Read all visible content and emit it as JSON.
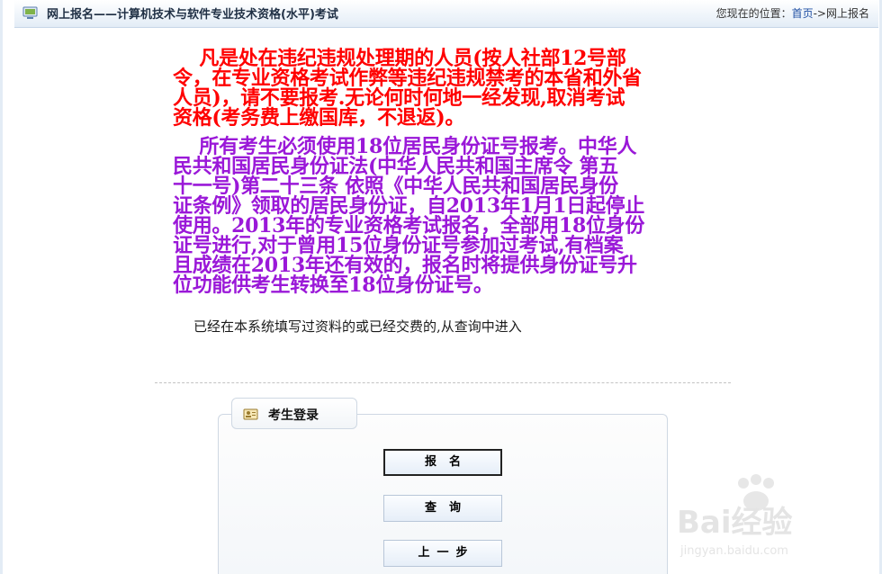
{
  "header": {
    "title": "网上报名——计算机技术与软件专业技术资格(水平)考试",
    "icon": "monitor-icon",
    "breadcrumb": {
      "prefix": "您现在的位置：",
      "home": "首页",
      "separator": "->",
      "current": "网上报名"
    }
  },
  "notices": {
    "red_lines": [
      "    凡是处在违纪违规处理期的人员(按人社部12号部",
      "令，在专业资格考试作弊等违纪违规禁考的本省和外省",
      "人员)，请不要报考.无论何时何地一经发现,取消考试",
      "资格(考务费上缴国库，不退返)。"
    ],
    "purple_lines": [
      "    所有考生必须使用18位居民身份证号报考。中华人",
      "民共和国居民身份证法(中华人民共和国主席令 第五",
      "十一号)第二十三条 依照《中华人民共和国居民身份",
      "证条例》领取的居民身份证，自2013年1月1日起停止",
      "使用。2013年的专业资格考试报名，全部用18位身份",
      "证号进行,对于曾用15位身份证号参加过考试,有档案",
      "且成绩在2013年还有效的，报名时将提供身份证号升",
      "位功能供考生转换至18位身份证号。"
    ],
    "red_color": "#ff0000",
    "purple_color": "#9a18d8"
  },
  "hint": "已经在本系统填写过资料的或已经交费的,从查询中进入",
  "login": {
    "tab_label": "考生登录",
    "tab_icon": "id-card-icon",
    "buttons": {
      "register": "报名",
      "query": "查询",
      "back": "上一步"
    }
  },
  "watermark": {
    "brand": "Bai经验",
    "url": "jingyan.baidu.com",
    "icon": "paw-icon"
  }
}
